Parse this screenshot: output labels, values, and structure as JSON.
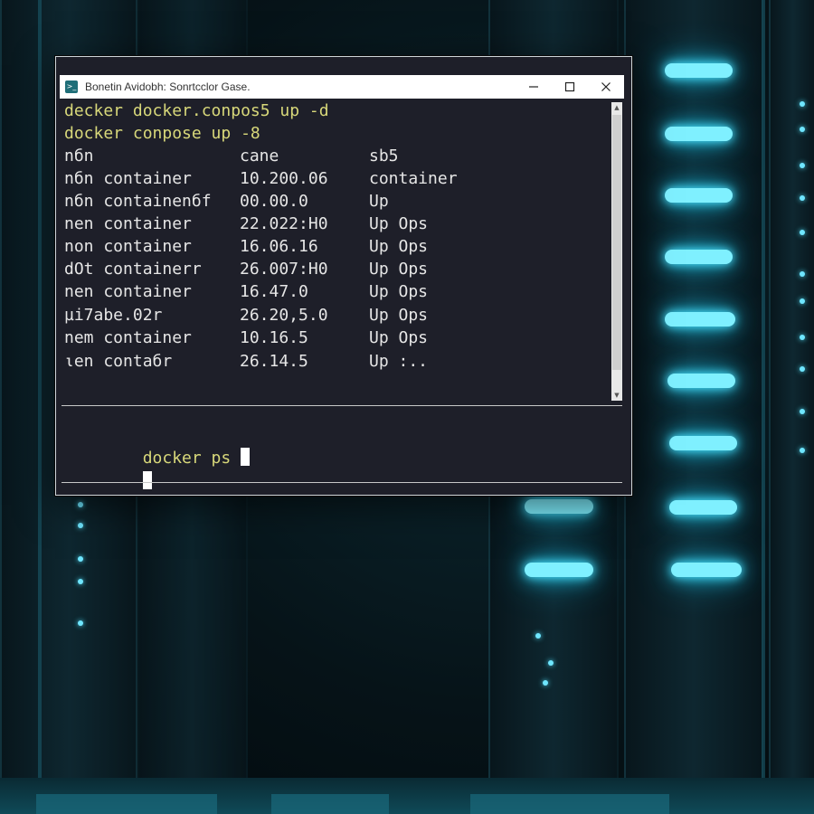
{
  "window": {
    "title": "Bonetin Avidobh: Sonrtcclor Gase.",
    "icon": "terminal-app-icon",
    "controls": [
      "minimize-icon",
      "maximize-icon",
      "close-icon"
    ]
  },
  "terminal": {
    "history": [
      "decker docker.conpos5 up -d",
      "docker conpose up -8"
    ],
    "table": {
      "headers": [
        "nбn",
        "cane",
        "sb5"
      ],
      "rows": [
        [
          "nбn container",
          "10.200.06",
          "container"
        ],
        [
          "nбn containenбf",
          "00.00.0",
          "Up"
        ],
        [
          "nen container",
          "22.022:H0",
          "Up Ops"
        ],
        [
          "non container",
          "16.06.16",
          "Up Ops"
        ],
        [
          "dOt containerr",
          "26.007:H0",
          "Up Ops"
        ],
        [
          "nen container",
          "16.47.0",
          "Up Ops"
        ],
        [
          "µi7abe.02r",
          "26.20,5.0",
          "Up Ops"
        ],
        [
          "nem container",
          "10.16.5",
          "Up Ops"
        ],
        [
          "ιen contaбr",
          "26.14.5",
          "Up :.."
        ]
      ]
    },
    "prompt_command": "docker ps"
  },
  "colors": {
    "command_text": "#d8d87a",
    "output_text": "#e6e6e6",
    "terminal_bg": "#1e1f29",
    "glow": "#7ff0ff"
  }
}
